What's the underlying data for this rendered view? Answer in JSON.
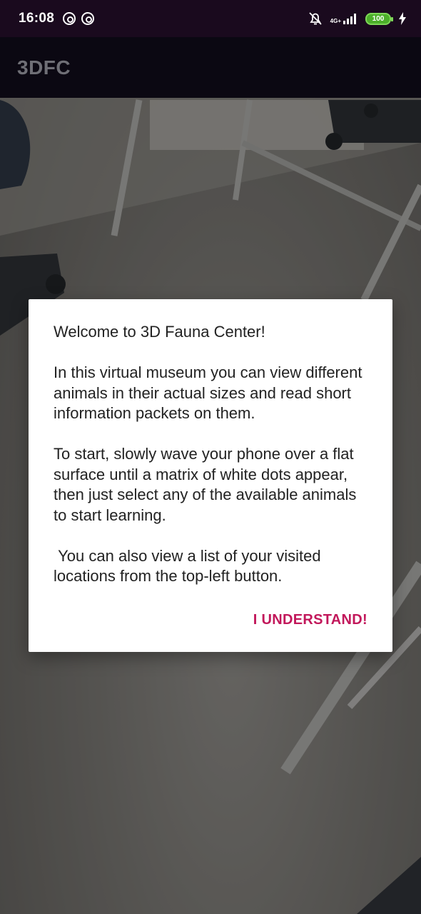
{
  "status_bar": {
    "time": "16:08",
    "network_label": "4G+",
    "battery_level": "100",
    "icons": [
      "sync-icon",
      "sync-icon",
      "alarm-off-icon",
      "signal-icon",
      "battery-icon",
      "charging-bolt-icon"
    ]
  },
  "app_bar": {
    "title": "3DFC"
  },
  "dialog": {
    "message": "Welcome to 3D Fauna Center!\n\nIn this virtual museum you can view different animals in their actual sizes and read short information packets on them.\n\nTo start, slowly wave your phone over a flat surface until a matrix of white dots appear, then just select any of the available animals to start learning.\n\n You can also view a list of your visited locations from the top-left button.",
    "confirm_label": "I UNDERSTAND!"
  },
  "colors": {
    "status_bar_bg": "#1a0a1e",
    "app_bar_bg": "#0b0812",
    "accent": "#c2185b",
    "battery": "#4caf2a"
  }
}
